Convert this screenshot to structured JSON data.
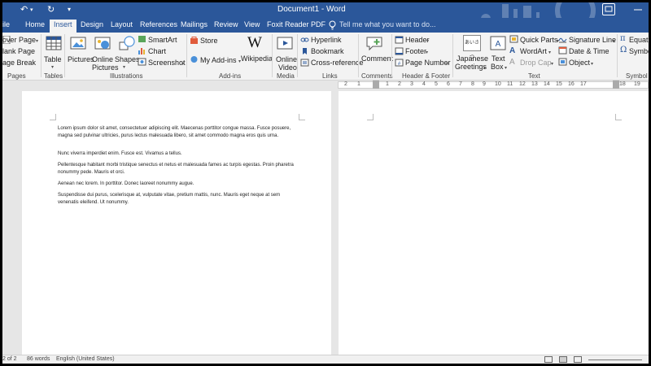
{
  "app": {
    "title": "Document1 - Word",
    "qa_undo": "↶",
    "qa_redo": "↻",
    "qa_more": "▾"
  },
  "tabs": [
    {
      "label": "ile"
    },
    {
      "label": "Home"
    },
    {
      "label": "Insert",
      "active": true
    },
    {
      "label": "Design"
    },
    {
      "label": "Layout"
    },
    {
      "label": "References"
    },
    {
      "label": "Mailings"
    },
    {
      "label": "Review"
    },
    {
      "label": "View"
    },
    {
      "label": "Foxit Reader PDF"
    }
  ],
  "tell_me": "Tell me what you want to do...",
  "ribbon": {
    "pages": {
      "group": "Pages",
      "cover_page": "over Page",
      "blank_page": "lank Page",
      "page_break": "age Break"
    },
    "tables": {
      "group": "Tables",
      "table": "Table"
    },
    "illustrations": {
      "group": "Illustrations",
      "pictures": "Pictures",
      "online_pictures_1": "Online",
      "online_pictures_2": "Pictures",
      "shapes": "Shapes",
      "smartart": "SmartArt",
      "chart": "Chart",
      "screenshot": "Screenshot"
    },
    "addins": {
      "group": "Add-ins",
      "store": "Store",
      "my_addins": "My Add-ins",
      "wikipedia": "Wikipedia"
    },
    "media": {
      "group": "Media",
      "online_video_1": "Online",
      "online_video_2": "Video"
    },
    "links": {
      "group": "Links",
      "hyperlink": "Hyperlink",
      "bookmark": "Bookmark",
      "cross_reference": "Cross-reference"
    },
    "comments": {
      "group": "Comments",
      "comment": "Comment"
    },
    "header_footer": {
      "group": "Header & Footer",
      "header": "Header",
      "footer": "Footer",
      "page_number": "Page Number"
    },
    "text": {
      "group": "Text",
      "japanese_1": "Japanese",
      "japanese_2": "Greetings",
      "textbox_1": "Text",
      "textbox_2": "Box",
      "quick_parts": "Quick Parts",
      "wordart": "WordArt",
      "drop_cap": "Drop Cap",
      "signature_line": "Signature Line",
      "date_time": "Date & Time",
      "object": "Object",
      "japanese_icon_text": "あいさつ"
    },
    "symbols": {
      "group": "Symbol",
      "equation": "Equatio",
      "symbol": "Symbo"
    }
  },
  "ruler_numbers": [
    "2",
    "1",
    "1",
    "2",
    "3",
    "4",
    "5",
    "6",
    "7",
    "8",
    "9",
    "10",
    "11",
    "12",
    "13",
    "14",
    "15",
    "16",
    "17",
    "18",
    "19"
  ],
  "document": {
    "paragraphs": [
      "Lorem ipsum dolor sit amet, consectetuer adipiscing elit. Maecenas porttitor congue massa. Fusce posuere, magna sed pulvinar ultricies, purus lectus malesuada libero, sit amet commodo magna eros quis urna.",
      "Nunc viverra imperdiet enim. Fusce est. Vivamus a tellus.",
      "Pellentesque habitant morbi tristique senectus et netus      et malesuada fames ac turpis egestas. Proin pharetra nonummy pede. Mauris et orci.",
      "Aenean nec lorem. In porttitor. Donec laoreet nonummy augue.",
      "Suspendisse dui purus, scelerisque at, vulputate vitae, pretium mattis, nunc. Mauris eget neque at sem venenatis eleifend. Ut nonummy."
    ]
  },
  "status": {
    "page": "2 of 2",
    "words": "86 words",
    "language": "English (United States)"
  },
  "colors": {
    "accent": "#2b579a",
    "ribbon": "#f3f3f3",
    "workspace": "#e6e6e6"
  }
}
